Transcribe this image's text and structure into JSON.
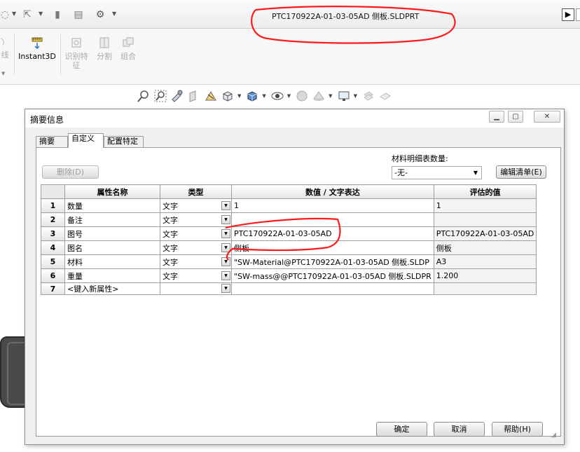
{
  "app": {
    "document_title": "PTC170922A-01-03-05AD 侧板.SLDPRT"
  },
  "ribbon": {
    "items": [
      {
        "label": "线",
        "enabled": false
      },
      {
        "label": "Instant3D",
        "enabled": true
      },
      {
        "label": "识别特征",
        "enabled": false
      },
      {
        "label": "分割",
        "enabled": false
      },
      {
        "label": "组合",
        "enabled": false
      }
    ]
  },
  "dialog": {
    "title": "摘要信息",
    "tabs": [
      {
        "label": "摘要",
        "active": false
      },
      {
        "label": "自定义",
        "active": true
      },
      {
        "label": "配置特定",
        "active": false
      }
    ],
    "delete_button": "删除(D)",
    "bom_qty_label": "材料明细表数量:",
    "bom_qty_value": "-无-",
    "edit_list_button": "编辑清单(E)",
    "grid": {
      "headers": [
        "属性名称",
        "类型",
        "数值 / 文字表达",
        "评估的值"
      ],
      "rows": [
        {
          "num": "1",
          "name": "数量",
          "type": "文字",
          "value": "1",
          "evaluated": "1"
        },
        {
          "num": "2",
          "name": "备注",
          "type": "文字",
          "value": "",
          "evaluated": ""
        },
        {
          "num": "3",
          "name": "图号",
          "type": "文字",
          "value": "PTC170922A-01-03-05AD",
          "evaluated": "PTC170922A-01-03-05AD"
        },
        {
          "num": "4",
          "name": "图名",
          "type": "文字",
          "value": "侧板",
          "evaluated": "侧板"
        },
        {
          "num": "5",
          "name": "材料",
          "type": "文字",
          "value": "\"SW-Material@PTC170922A-01-03-05AD 侧板.SLDP",
          "evaluated": "A3"
        },
        {
          "num": "6",
          "name": "重量",
          "type": "文字",
          "value": "\"SW-mass@@PTC170922A-01-03-05AD 侧板.SLDPR",
          "evaluated": "1.200"
        }
      ],
      "new_row": {
        "num": "7",
        "name": "<键入新属性>"
      }
    },
    "ok_button": "确定",
    "cancel_button": "取消",
    "help_button": "帮助(H)"
  },
  "colors": {
    "annotation": "#ff1a1a",
    "grid_border": "#a0a0a0"
  }
}
